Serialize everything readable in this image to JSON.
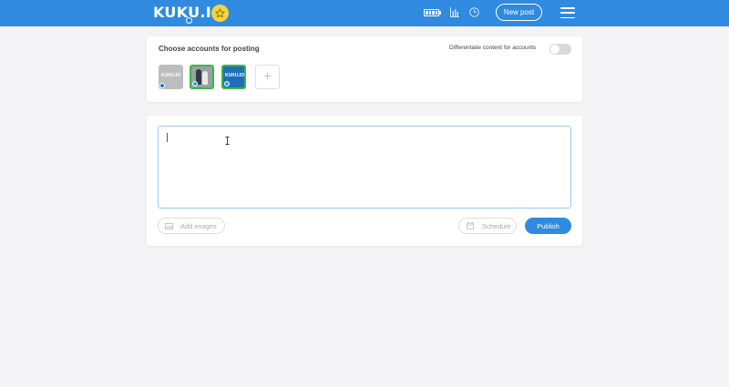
{
  "header": {
    "logo_text": "KUKU.IO",
    "new_post_label": "New post",
    "icons": [
      "battery-icon",
      "stats-icon",
      "clock-icon",
      "menu-icon",
      "star-icon"
    ],
    "brand_color": "#2f8ae0",
    "star_color": "#f5d43c"
  },
  "accounts": {
    "title": "Choose accounts for posting",
    "differentiate_label": "Differentiate content for accounts",
    "differentiate_on": false,
    "items": [
      {
        "avatar_text": "KUKU.IO",
        "network": "facebook",
        "selected": false
      },
      {
        "avatar_text": "",
        "network": "twitter",
        "selected": true
      },
      {
        "avatar_text": "KUKU.IO",
        "network": "twitter",
        "selected": true
      }
    ],
    "selected_color": "#3cb54a",
    "add_label": "+"
  },
  "post": {
    "text_value": "",
    "add_images_label": "Add images",
    "schedule_label": "Schedule",
    "publish_label": "Publish"
  }
}
